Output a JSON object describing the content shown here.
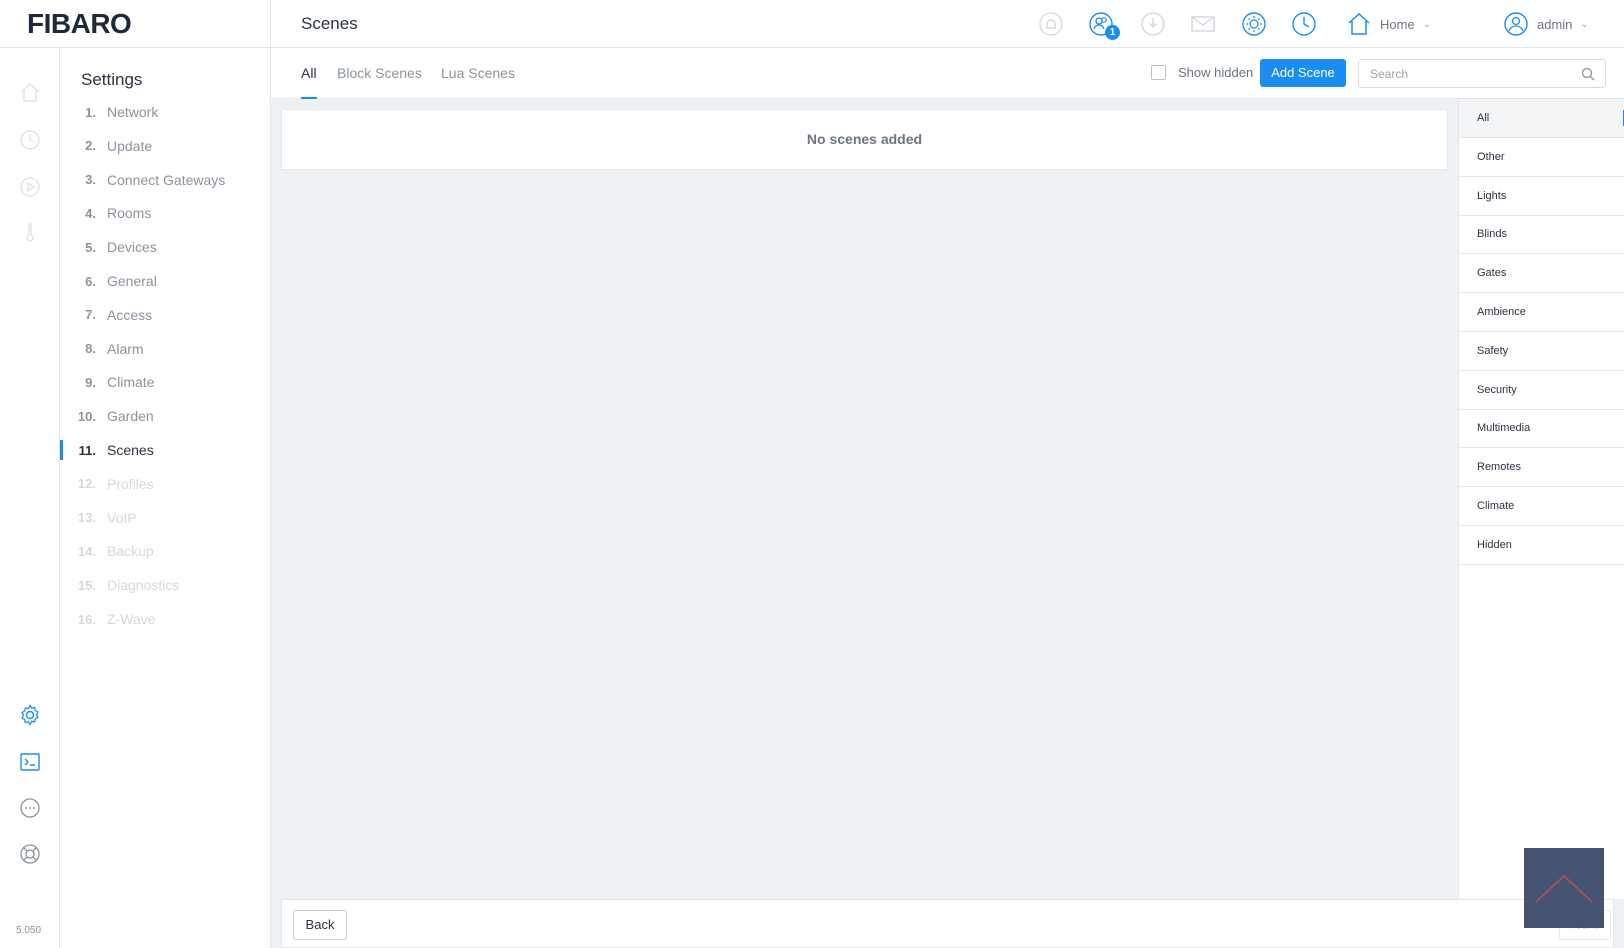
{
  "app": {
    "logo": "FIBARO",
    "version": "5.050"
  },
  "header": {
    "title": "Scenes",
    "notifications_badge": "1",
    "home_label": "Home",
    "user_label": "admin"
  },
  "settings": {
    "title": "Settings",
    "items": [
      {
        "num": "1.",
        "label": "Network",
        "state": "normal"
      },
      {
        "num": "2.",
        "label": "Update",
        "state": "normal"
      },
      {
        "num": "3.",
        "label": "Connect Gateways",
        "state": "normal"
      },
      {
        "num": "4.",
        "label": "Rooms",
        "state": "normal"
      },
      {
        "num": "5.",
        "label": "Devices",
        "state": "normal"
      },
      {
        "num": "6.",
        "label": "General",
        "state": "normal"
      },
      {
        "num": "7.",
        "label": "Access",
        "state": "normal"
      },
      {
        "num": "8.",
        "label": "Alarm",
        "state": "normal"
      },
      {
        "num": "9.",
        "label": "Climate",
        "state": "normal"
      },
      {
        "num": "10.",
        "label": "Garden",
        "state": "normal"
      },
      {
        "num": "11.",
        "label": "Scenes",
        "state": "active"
      },
      {
        "num": "12.",
        "label": "Profiles",
        "state": "disabled"
      },
      {
        "num": "13.",
        "label": "VoIP",
        "state": "disabled"
      },
      {
        "num": "14.",
        "label": "Backup",
        "state": "disabled"
      },
      {
        "num": "15.",
        "label": "Diagnostics",
        "state": "disabled"
      },
      {
        "num": "16.",
        "label": "Z-Wave",
        "state": "disabled"
      }
    ]
  },
  "tabs": {
    "all": "All",
    "block": "Block Scenes",
    "lua": "Lua Scenes",
    "show_hidden": "Show hidden",
    "add_scene": "Add Scene",
    "search_placeholder": "Search"
  },
  "main": {
    "empty_message": "No scenes added"
  },
  "categories": [
    "All",
    "Other",
    "Lights",
    "Blinds",
    "Gates",
    "Ambience",
    "Safety",
    "Security",
    "Multimedia",
    "Remotes",
    "Climate",
    "Hidden"
  ],
  "footer": {
    "back": "Back",
    "next": "Next"
  },
  "colors": {
    "accent": "#1a8df0",
    "icon": "#1a8df0",
    "icon_disabled": "#cfd6dd",
    "content_bg": "#eef1f4"
  }
}
